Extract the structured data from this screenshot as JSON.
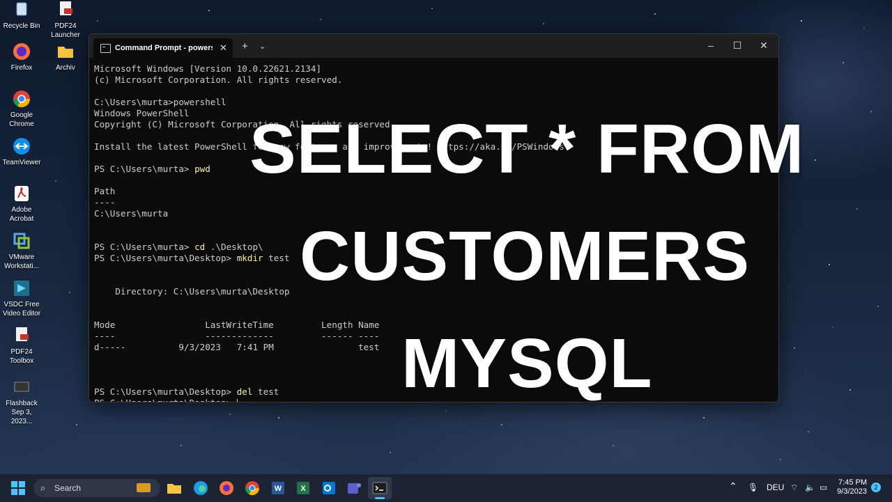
{
  "desktop": {
    "icons": [
      {
        "label": "Recycle Bin",
        "icon": "recycle-bin-icon"
      },
      {
        "label": "PDF24 Launcher",
        "icon": "pdf24-icon"
      },
      {
        "label": "Firefox",
        "icon": "firefox-icon"
      },
      {
        "label": "Archiv",
        "icon": "folder-icon"
      },
      {
        "label": "Google Chrome",
        "icon": "chrome-icon"
      },
      {
        "label": "TeamViewer",
        "icon": "teamviewer-icon"
      },
      {
        "label": "Adobe Acrobat",
        "icon": "acrobat-icon"
      },
      {
        "label": "VMware Workstati...",
        "icon": "vmware-icon"
      },
      {
        "label": "VSDC Free Video Editor",
        "icon": "vsdc-icon"
      },
      {
        "label": "PDF24 Toolbox",
        "icon": "pdf24-icon"
      },
      {
        "label": "Flashback Sep 3, 2023...",
        "icon": "video-file-icon"
      }
    ]
  },
  "terminal": {
    "tab_title": "Command Prompt - powershe",
    "lines": [
      {
        "text": "Microsoft Windows [Version 10.0.22621.2134]"
      },
      {
        "text": "(c) Microsoft Corporation. All rights reserved."
      },
      {
        "text": ""
      },
      {
        "text": "C:\\Users\\murta>powershell"
      },
      {
        "text": "Windows PowerShell"
      },
      {
        "text": "Copyright (C) Microsoft Corporation. All rights reserved."
      },
      {
        "text": ""
      },
      {
        "text": "Install the latest PowerShell for new features and improvements! https://aka.ms/PSWindows"
      },
      {
        "text": ""
      },
      {
        "prompt": "PS C:\\Users\\murta> ",
        "cmd": "pwd"
      },
      {
        "text": ""
      },
      {
        "text": "Path"
      },
      {
        "text": "----"
      },
      {
        "text": "C:\\Users\\murta"
      },
      {
        "text": ""
      },
      {
        "text": ""
      },
      {
        "prompt": "PS C:\\Users\\murta> ",
        "cmd": "cd",
        "rest": " .\\Desktop\\"
      },
      {
        "prompt": "PS C:\\Users\\murta\\Desktop> ",
        "cmd": "mkdir",
        "rest": " test"
      },
      {
        "text": ""
      },
      {
        "text": ""
      },
      {
        "text": "    Directory: C:\\Users\\murta\\Desktop"
      },
      {
        "text": ""
      },
      {
        "text": ""
      },
      {
        "text": "Mode                 LastWriteTime         Length Name"
      },
      {
        "text": "----                 -------------         ------ ----"
      },
      {
        "text": "d-----          9/3/2023   7:41 PM                test"
      },
      {
        "text": ""
      },
      {
        "text": ""
      },
      {
        "text": ""
      },
      {
        "prompt": "PS C:\\Users\\murta\\Desktop> ",
        "cmd": "del",
        "rest": " test"
      },
      {
        "prompt": "PS C:\\Users\\murta\\Desktop> ",
        "cursor": true
      }
    ]
  },
  "overlay": {
    "line1": "SELECT * FROM",
    "line2": "CUSTOMERS",
    "line3": "MYSQL"
  },
  "taskbar": {
    "search_placeholder": "Search",
    "language": "DEU",
    "time": "7:45 PM",
    "date": "9/3/2023",
    "notification_count": "2"
  }
}
